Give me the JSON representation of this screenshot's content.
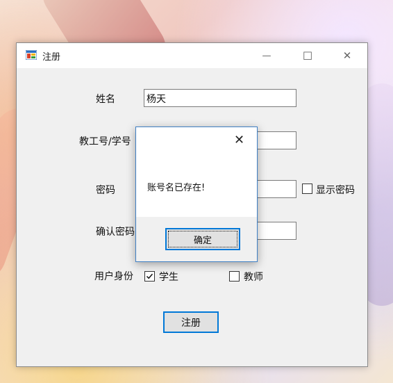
{
  "window": {
    "title": "注册",
    "controls": {
      "minimize": "—",
      "maximize": "☐",
      "close": "✕"
    }
  },
  "form": {
    "name_label": "姓名",
    "name_value": "杨天",
    "id_label": "教工号/学号",
    "id_value": "",
    "password_label": "密码",
    "password_value": "",
    "show_password_label": "显示密码",
    "show_password_checked": false,
    "confirm_label": "确认密码",
    "confirm_value": "",
    "role_label": "用户身份",
    "role_student_label": "学生",
    "role_student_checked": true,
    "role_teacher_label": "教师",
    "role_teacher_checked": false,
    "submit_label": "注册"
  },
  "dialog": {
    "message": "账号名已存在!",
    "ok_label": "确定",
    "close_glyph": "✕"
  },
  "colors": {
    "accent": "#0078d7",
    "window_bg": "#f0f0f0",
    "titlebar_bg": "#ffffff"
  }
}
